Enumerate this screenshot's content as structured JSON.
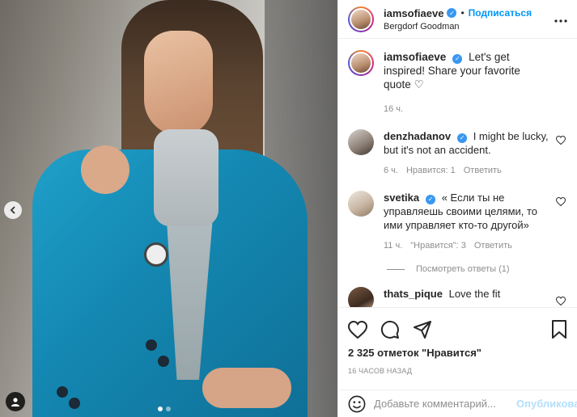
{
  "colors": {
    "accent": "#0095f6",
    "verified": "#3897f0",
    "muted": "#8e8e8e",
    "publish_disabled": "#b2dffc"
  },
  "photo": {
    "nav_prev_icon": "chevron-left-icon",
    "tag_icon": "user-tag-icon",
    "slides_total": 2,
    "active_slide": 1
  },
  "header": {
    "username": "iamsofiaeve",
    "verified_icon": "verified-badge-icon",
    "separator": "•",
    "follow_label": "Подписаться",
    "location": "Bergdorf Goodman",
    "more_icon": "more-options-icon"
  },
  "caption": {
    "username": "iamsofiaeve",
    "text": "Let's get inspired! Share your favorite quote",
    "heart_emoji": "♡",
    "time": "16 ч."
  },
  "comments": [
    {
      "username": "denzhadanov",
      "verified": true,
      "text": "I might be lucky, but it's not an accident.",
      "time": "6 ч.",
      "likes_label": "Нравится: 1",
      "reply_label": "Ответить"
    },
    {
      "username": "svetika",
      "verified": true,
      "text": "« Если ты не управляешь своими целями, то ими управляет кто-то другой»",
      "time": "11 ч.",
      "likes_label": "\"Нравится\": 3",
      "reply_label": "Ответить",
      "view_replies": "Посмотреть ответы (1)"
    },
    {
      "username": "thats_pique",
      "verified": false,
      "text": "Love the fit"
    }
  ],
  "actions": {
    "like_icon": "heart-icon",
    "comment_icon": "comment-icon",
    "share_icon": "send-icon",
    "save_icon": "bookmark-icon",
    "likes_count": "2 325 отметок \"Нравится\"",
    "posted_ago": "16 ЧАСОВ НАЗАД"
  },
  "add_comment": {
    "emoji_icon": "emoji-icon",
    "placeholder": "Добавьте комментарий...",
    "publish_label": "Опубликовать"
  }
}
